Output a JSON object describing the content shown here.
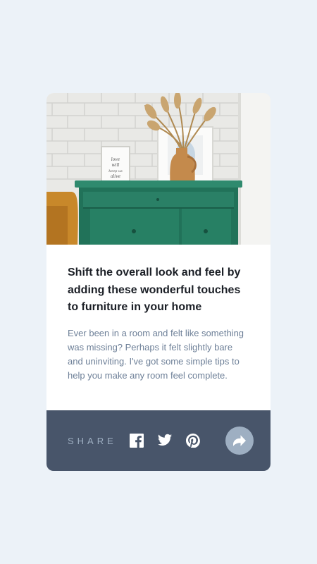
{
  "article": {
    "title": "Shift the overall look and feel by adding these wonderful touches to furniture in your home",
    "excerpt": "Ever been in a room and felt like something was missing? Perhaps it felt slightly bare and uninviting. I've got some simple tips to help you make any room feel complete.",
    "image_alt": "Green drawers with vase and picture frames on a white brick wall"
  },
  "share": {
    "label": "SHARE",
    "icons": [
      "facebook-icon",
      "twitter-icon",
      "pinterest-icon",
      "share-arrow-icon"
    ]
  },
  "colors": {
    "page_bg": "#ecf2f8",
    "card_bg": "#ffffff",
    "share_bar": "#48556a",
    "share_button": "#9eafc2",
    "title": "#1b1f26",
    "excerpt": "#6e8098"
  }
}
